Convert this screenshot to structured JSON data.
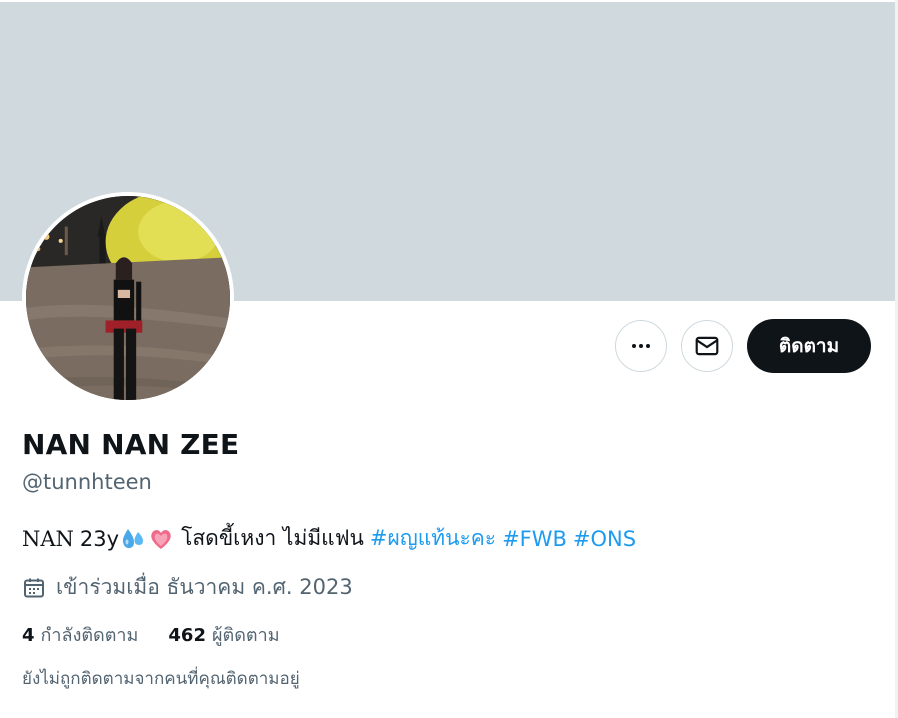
{
  "profile": {
    "display_name": "NAN NAN ZEE",
    "handle": "@tunnhteen",
    "bio": {
      "name_part": "NAN",
      "age_part": "23y",
      "emojis": [
        "sweat-droplets-emoji",
        "heartpulse-emoji"
      ],
      "text": "โสดขี้เหงา ไม่มีแฟน",
      "hashtags": [
        "#ผญแท้นะคะ",
        "#FWB",
        "#ONS"
      ]
    },
    "joined": {
      "icon": "calendar-icon",
      "text": "เข้าร่วมเมื่อ ธันวาคม ค.ศ. 2023"
    },
    "stats": {
      "following_count": "4",
      "following_label": "กำลังติดตาม",
      "followers_count": "462",
      "followers_label": "ผู้ติดตาม"
    },
    "notice": "ยังไม่ถูกติดตามจากคนที่คุณติดตามอยู่"
  },
  "actions": {
    "more_icon": "more-horizontal-icon",
    "message_icon": "envelope-icon",
    "follow_label": "ติดตาม"
  },
  "colors": {
    "banner": "#cfd9de",
    "accent": "#1d9bf0",
    "primary_text": "#0f1419",
    "secondary_text": "#536471",
    "follow_button": "#0f1419"
  }
}
